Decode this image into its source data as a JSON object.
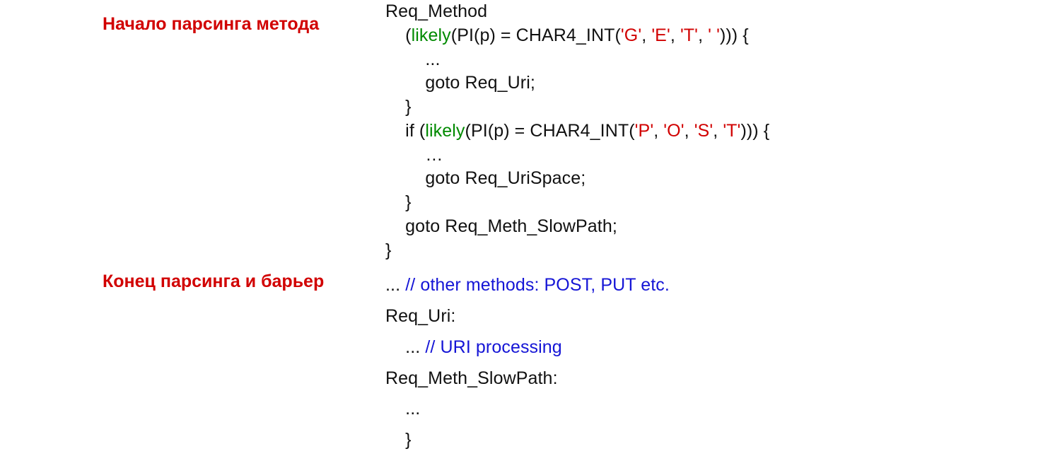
{
  "annotations": {
    "start": "Начало парсинга метода",
    "end": "Конец парсинга и барьер"
  },
  "code": {
    "l01": "Req_Method",
    "l02a": "    (",
    "l02b": "likely",
    "l02c": "(PI(p) = CHAR4_INT(",
    "l02d": "'G'",
    "l02e": ", ",
    "l02f": "'E'",
    "l02g": ", ",
    "l02h": "'T'",
    "l02i": ", ",
    "l02j": "' '",
    "l02k": "))) {",
    "l03": "        ...",
    "l04": "        goto Req_Uri;",
    "l05": "    }",
    "l06a": "    if (",
    "l06b": "likely",
    "l06c": "(PI(p) = CHAR4_INT(",
    "l06d": "'P'",
    "l06e": ", ",
    "l06f": "'O'",
    "l06g": ", ",
    "l06h": "'S'",
    "l06i": ", ",
    "l06j": "'T'",
    "l06k": "))) {",
    "l07": "        …",
    "l08": "        goto Req_UriSpace;",
    "l09": "    }",
    "l10": "    goto Req_Meth_SlowPath;",
    "l11": "}",
    "l12a": "... ",
    "l12b": "// other methods: POST, PUT etc.",
    "l13": "Req_Uri:",
    "l14a": "    ... ",
    "l14b": "// URI processing",
    "l15": "Req_Meth_SlowPath:",
    "l16": "    ...",
    "l17": "    }"
  }
}
